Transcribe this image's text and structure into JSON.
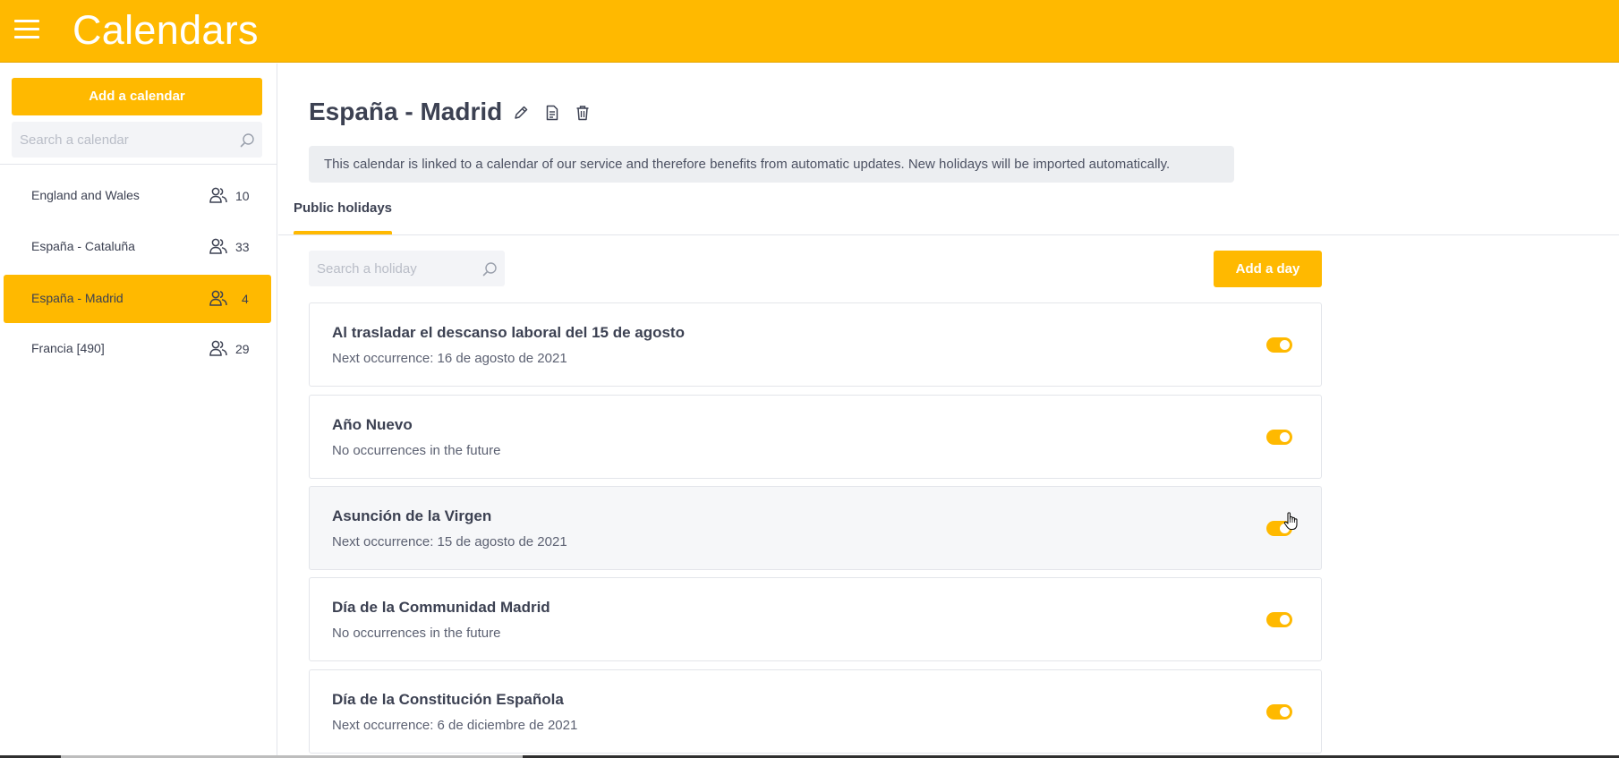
{
  "header": {
    "title": "Calendars",
    "menu_icon": "hamburger-menu-icon"
  },
  "sidebar": {
    "add_button": "Add a calendar",
    "search_placeholder": "Search a calendar",
    "items": [
      {
        "label": "England and Wales",
        "count": "10",
        "active": false
      },
      {
        "label": "España - Cataluña",
        "count": "33",
        "active": false
      },
      {
        "label": "España - Madrid",
        "count": "4",
        "active": true
      },
      {
        "label": "Francia [490]",
        "count": "29",
        "active": false
      }
    ]
  },
  "main": {
    "title": "España - Madrid",
    "toolbar_icons": [
      "edit-pencil-icon",
      "document-icon",
      "trash-icon"
    ],
    "info": "This calendar is linked to a calendar of our service and therefore benefits from automatic updates. New holidays will be imported automatically.",
    "tabs": [
      {
        "label": "Public holidays",
        "active": true
      }
    ],
    "holiday_search_placeholder": "Search a holiday",
    "add_day_button": "Add a day",
    "holidays": [
      {
        "name": "Al trasladar el descanso laboral del 15 de agosto",
        "next": "Next occurrence: 16 de agosto de 2021",
        "enabled": true
      },
      {
        "name": "Año Nuevo",
        "next": "No occurrences in the future",
        "enabled": true
      },
      {
        "name": "Asunción de la Virgen",
        "next": "Next occurrence: 15 de agosto de 2021",
        "enabled": true
      },
      {
        "name": "Día de la Communidad Madrid",
        "next": "No occurrences in the future",
        "enabled": true
      },
      {
        "name": "Día de la Constitución Española",
        "next": "Next occurrence: 6 de diciembre de 2021",
        "enabled": true
      }
    ]
  },
  "colors": {
    "accent": "#ffb900",
    "text": "#3c4152",
    "muted_bg": "#eceef1"
  }
}
